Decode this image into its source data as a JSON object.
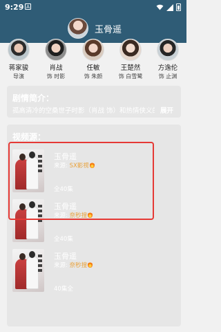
{
  "status_bar": {
    "time": "9:29",
    "notification_badge": "A",
    "icons": [
      "wifi-icon",
      "signal-icon",
      "battery-icon"
    ]
  },
  "header": {
    "title": "玉骨遥",
    "avatar_icon": "show-avatar"
  },
  "cast": [
    {
      "name": "蒋家骏",
      "role": "导演"
    },
    {
      "name": "肖战",
      "role": "饰 时影"
    },
    {
      "name": "任敏",
      "role": "饰 朱颜"
    },
    {
      "name": "王楚然",
      "role": "饰 白雪鹭"
    },
    {
      "name": "方逸伦",
      "role": "饰 止渊"
    }
  ],
  "synopsis": {
    "heading": "剧情简介：",
    "text": "孤高清冷的空桑世子时影（肖战 饰）和热情侠义的赤族郡主朱颜（任敏 饰），因一花之缘结…",
    "expand_label": "展开"
  },
  "sources": {
    "heading": "视频源：",
    "items": [
      {
        "title": "玉骨遥",
        "source_label": "来源:",
        "source_name": "SX影视",
        "episodes": "全40集"
      },
      {
        "title": "玉骨遥",
        "source_label": "来源:",
        "source_name": "奈秒搜",
        "episodes": "全40集"
      },
      {
        "title": "玉骨遥",
        "source_label": "来源:",
        "source_name": "奈秒搜",
        "episodes": "40集全"
      }
    ]
  },
  "colors": {
    "header_bg": "#2f5c76",
    "highlight": "#e53935",
    "source_accent": "#e9a23b"
  }
}
